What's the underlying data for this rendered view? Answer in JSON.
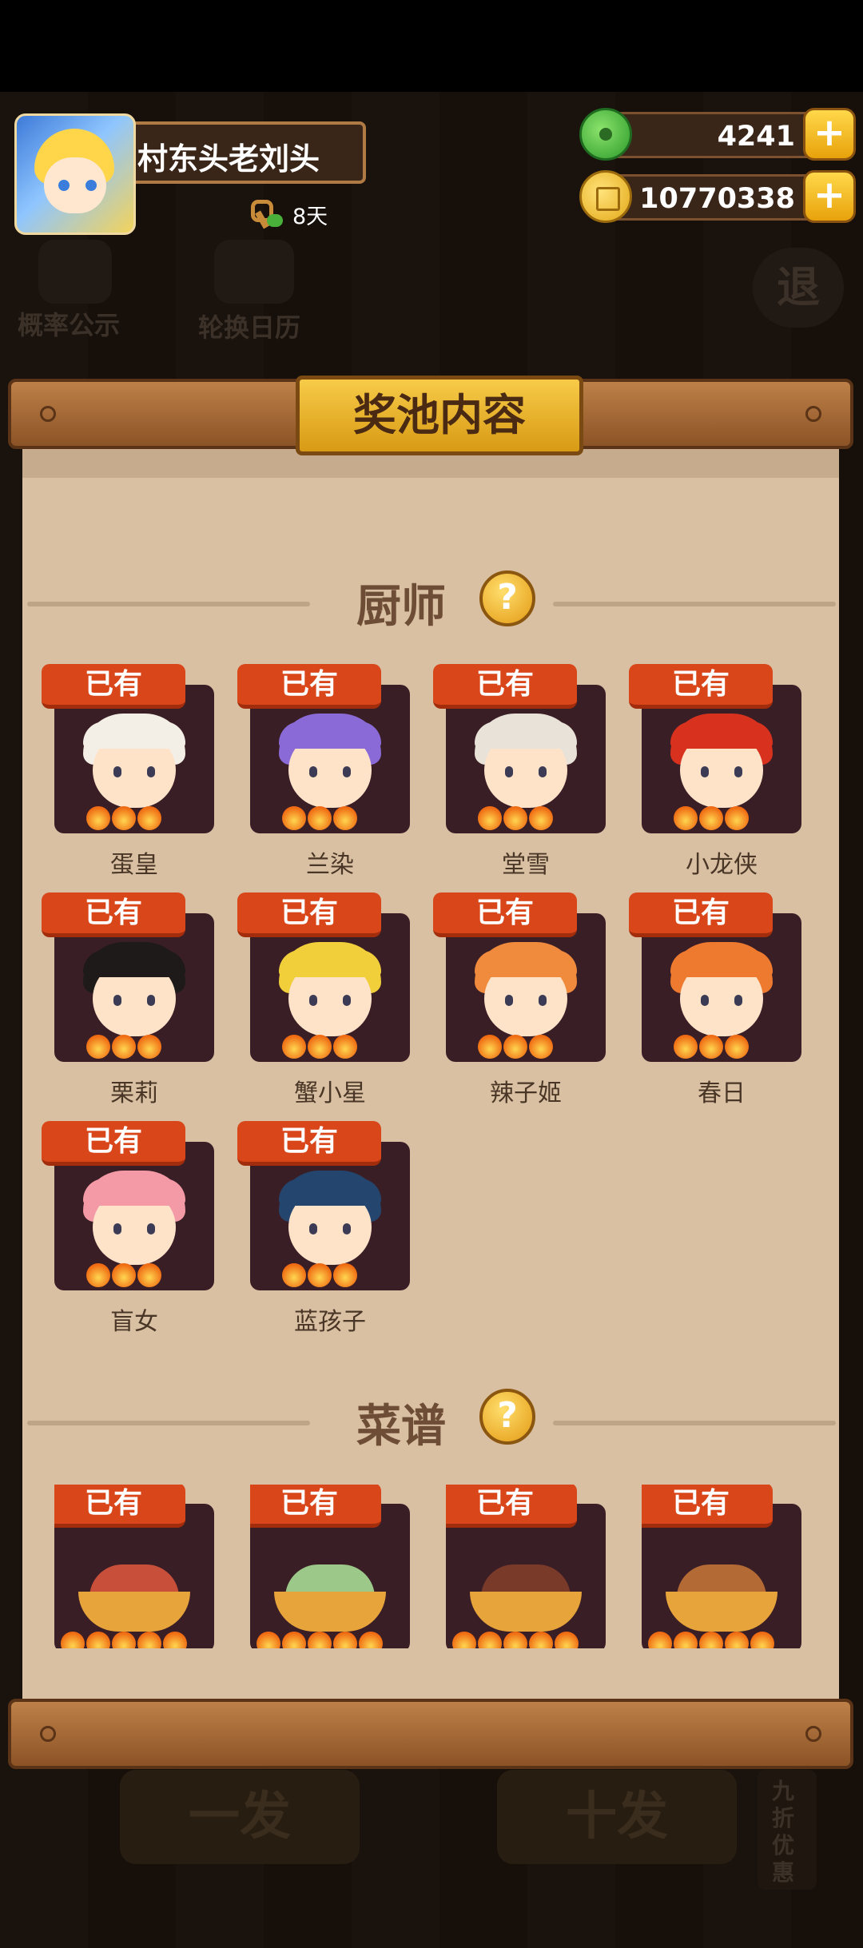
{
  "player": {
    "name": "村东头老刘头",
    "days": "8天"
  },
  "resources": {
    "jade": "4241",
    "coins": "10770338"
  },
  "background": {
    "probability": "概率公示",
    "calendar": "轮换日历",
    "exit": "退",
    "single_draw": "一发",
    "ten_draw": "十发",
    "discount": "九折优惠"
  },
  "panel": {
    "title": "奖池内容"
  },
  "chefs_section": {
    "title": "厨师",
    "help": "?"
  },
  "recipes_section": {
    "title": "菜谱",
    "help": "?"
  },
  "owned_label": "已有",
  "chefs": [
    {
      "name": "蛋皇",
      "hair": "#f4efe6"
    },
    {
      "name": "兰染",
      "hair": "#8a6ad6"
    },
    {
      "name": "堂雪",
      "hair": "#e9e2d8"
    },
    {
      "name": "小龙侠",
      "hair": "#d8321f"
    },
    {
      "name": "栗莉",
      "hair": "#1e1a1a"
    },
    {
      "name": "蟹小星",
      "hair": "#f1cf3a"
    },
    {
      "name": "辣子姬",
      "hair": "#f08a3c"
    },
    {
      "name": "春日",
      "hair": "#ee7a30"
    },
    {
      "name": "盲女",
      "hair": "#f49aa6"
    },
    {
      "name": "蓝孩子",
      "hair": "#24466e"
    }
  ],
  "recipes": [
    {
      "food": "#c8503a"
    },
    {
      "food": "#9cc98a"
    },
    {
      "food": "#7a3a2a"
    },
    {
      "food": "#b36a35"
    }
  ]
}
